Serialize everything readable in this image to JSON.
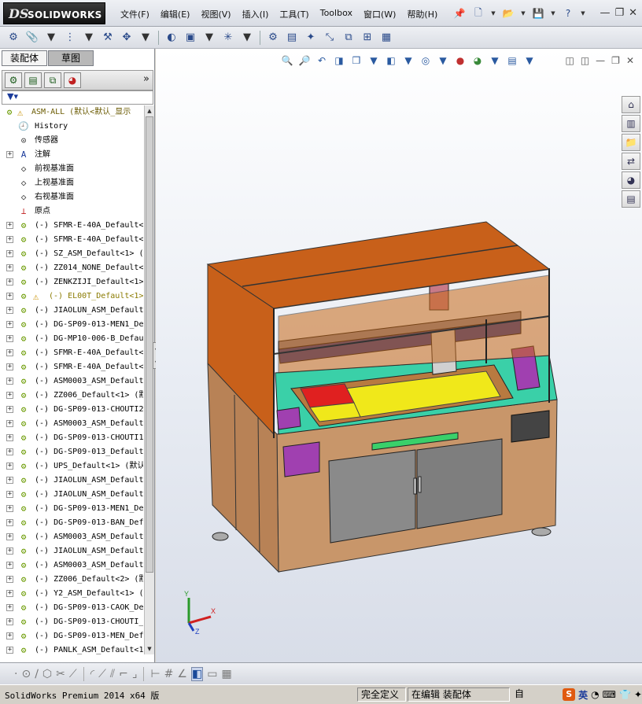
{
  "app": {
    "logo_ds": "DS",
    "logo_name": "SOLIDWORKS",
    "menus": [
      "文件(F)",
      "编辑(E)",
      "视图(V)",
      "插入(I)",
      "工具(T)",
      "Toolbox",
      "窗口(W)",
      "帮助(H)"
    ],
    "window_controls": [
      "—",
      "❐",
      "✕"
    ]
  },
  "panel": {
    "tabs": [
      "装配体",
      "草图"
    ],
    "more": "»",
    "filter": "▼▾"
  },
  "tree": {
    "root": "ASM-ALL  (默认<默认_显示",
    "fixed_items": [
      {
        "label": "History",
        "icon": "history-icon"
      },
      {
        "label": "传感器",
        "icon": "sensor-icon"
      },
      {
        "label": "注解",
        "icon": "annotation-icon"
      },
      {
        "label": "前视基准面",
        "icon": "plane-icon"
      },
      {
        "label": "上视基准面",
        "icon": "plane-icon"
      },
      {
        "label": "右视基准面",
        "icon": "plane-icon"
      },
      {
        "label": "原点",
        "icon": "origin-icon"
      }
    ],
    "components": [
      "(-) SFMR-E-40A_Default<",
      "(-) SFMR-E-40A_Default<",
      "(-) SZ_ASM_Default<1> (",
      "(-) ZZ014_NONE_Default<",
      "(-) ZENKZIJI_Default<1>",
      "(-) EL00T_Default<1>",
      "(-) JIAOLUN_ASM_Default",
      "(-) DG-SP09-013-MEN1_De",
      "(-) DG-MP10-006-B_Defau",
      "(-) SFMR-E-40A_Default<",
      "(-) SFMR-E-40A_Default<",
      "(-) ASM0003_ASM_Default",
      "(-) ZZ006_Default<1> (默",
      "(-) DG-SP09-013-CHOUTI2",
      "(-) ASM0003_ASM_Default",
      "(-) DG-SP09-013-CHOUTI1",
      "(-) DG-SP09-013_Default",
      "(-) UPS_Default<1> (默认",
      "(-) JIAOLUN_ASM_Default",
      "(-) JIAOLUN_ASM_Default",
      "(-) DG-SP09-013-MEN1_De",
      "(-) DG-SP09-013-BAN_Def",
      "(-) ASM0003_ASM_Default",
      "(-) JIAOLUN_ASM_Default",
      "(-) ASM0003_ASM_Default",
      "(-) ZZ006_Default<2> (默",
      "(-) Y2_ASM_Default<1> (",
      "(-) DG-SP09-013-CAOK_De",
      "(-) DG-SP09-013-CHOUTI_",
      "(-) DG-SP09-013-MEN_Def",
      "(-) PANLK_ASM_Default<1"
    ],
    "warned_index": 5
  },
  "triad": {
    "x": "X",
    "y": "Y",
    "z": "Z"
  },
  "status": {
    "product": "SolidWorks Premium 2014 x64 版",
    "state": "完全定义",
    "mode": "在编辑 装配体",
    "tail": "自",
    "ime_lang": "英"
  },
  "colors": {
    "cabinet_top": "#c8601a",
    "cabinet_base": "#c89a6a",
    "deck": "#3ad0a8",
    "table": "#f0e81a",
    "table_red": "#e02020",
    "rail": "#2a3a9a",
    "door": "#8a8a8a",
    "drawer": "#a040b0"
  }
}
